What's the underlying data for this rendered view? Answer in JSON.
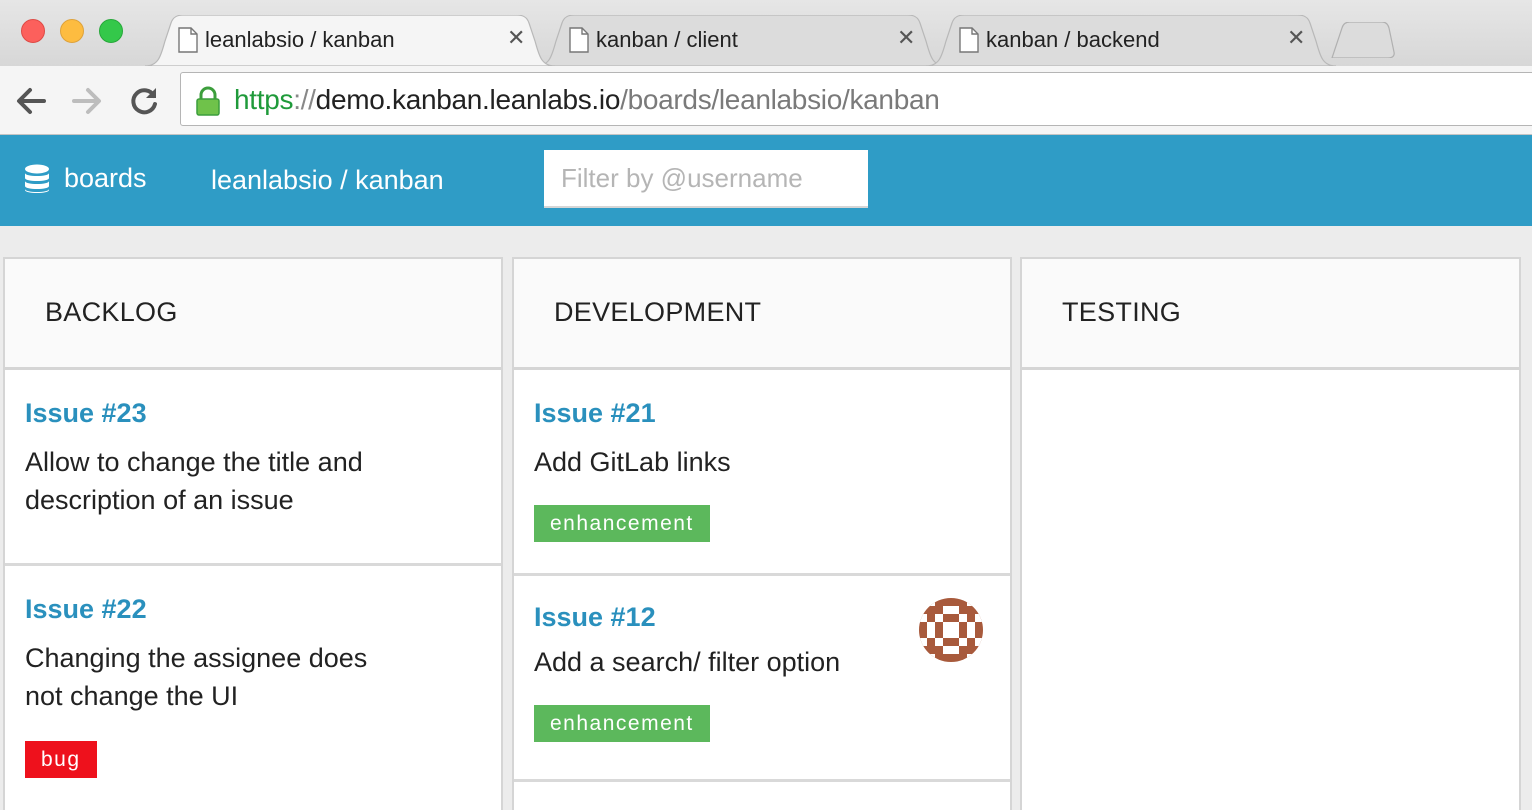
{
  "browser": {
    "tabs": [
      {
        "title": "leanlabsio / kanban",
        "active": true
      },
      {
        "title": "kanban / client",
        "active": false
      },
      {
        "title": "kanban / backend",
        "active": false
      }
    ],
    "url": {
      "scheme": "https",
      "separator": "://",
      "host": "demo.kanban.leanlabs.io",
      "path": "/boards/leanlabsio/kanban"
    }
  },
  "header": {
    "brand_label": "boards",
    "breadcrumb": "leanlabsio / kanban",
    "filter_placeholder": "Filter by @username",
    "bar_color": "#2f9cc6"
  },
  "columns": [
    {
      "title": "BACKLOG",
      "cards": [
        {
          "id": "Issue #23",
          "title": "Allow to change the title and description of an issue",
          "labels": []
        },
        {
          "id": "Issue #22",
          "title": "Changing the assignee does not change the UI",
          "labels": [
            {
              "text": "bug",
              "color": "#ee111c"
            }
          ]
        }
      ]
    },
    {
      "title": "DEVELOPMENT",
      "cards": [
        {
          "id": "Issue #21",
          "title": "Add GitLab links",
          "labels": [
            {
              "text": "enhancement",
              "color": "#5cb85c"
            }
          ]
        },
        {
          "id": "Issue #12",
          "title": "Add a search/ filter option",
          "labels": [
            {
              "text": "enhancement",
              "color": "#5cb85c"
            }
          ],
          "assignee_avatar": "pattern-avatar-icon"
        }
      ]
    },
    {
      "title": "TESTING",
      "cards": []
    }
  ]
}
